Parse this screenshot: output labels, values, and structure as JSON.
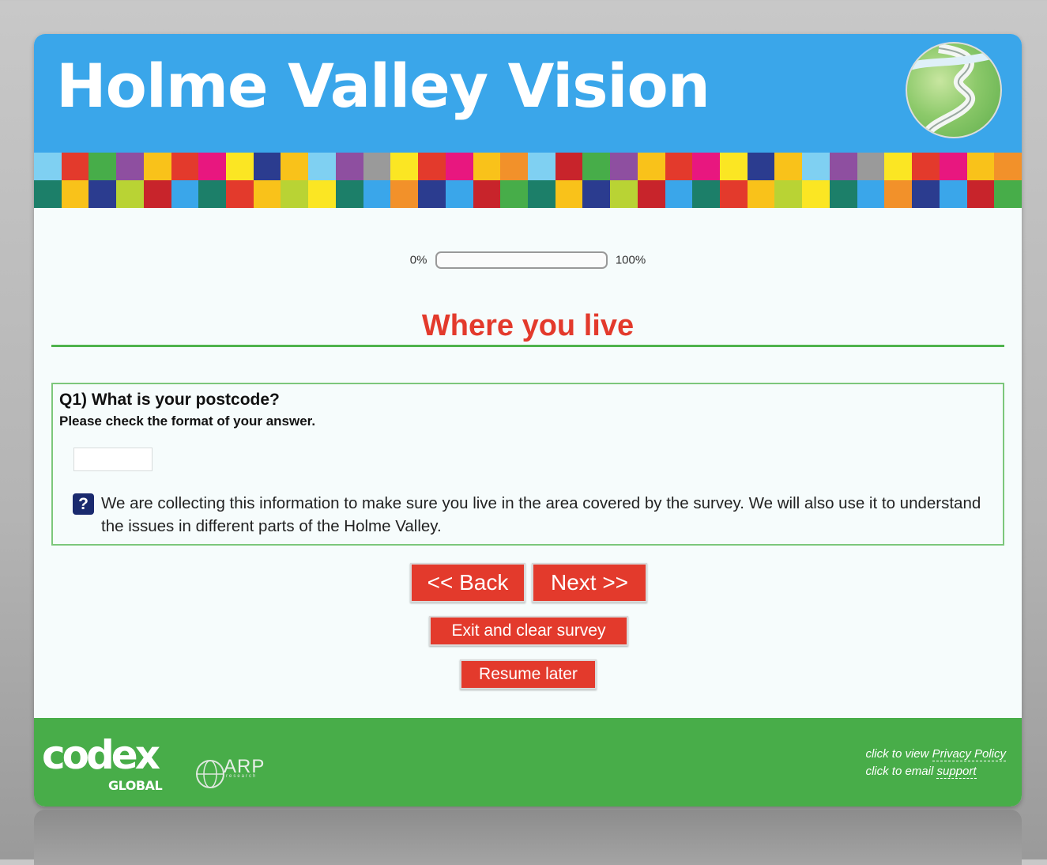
{
  "header": {
    "title": "Holme Valley Vision",
    "mosaic_colors": [
      "#7fd0f2",
      "#e33a2c",
      "#47ad49",
      "#8e4fa0",
      "#f9c21a",
      "#e33a2c",
      "#e8177f",
      "#fbe623",
      "#2b3c8f",
      "#f9c21a",
      "#7fd0f2",
      "#8e4fa0",
      "#9a9a9a",
      "#fbe623",
      "#e33a2c",
      "#e8177f",
      "#f9c21a",
      "#f2912a",
      "#7fd0f2",
      "#c8242b",
      "#47ad49",
      "#8e4fa0",
      "#f9c21a",
      "#e33a2c",
      "#e8177f",
      "#fbe623",
      "#2b3c8f",
      "#f9c21a",
      "#7fd0f2",
      "#8e4fa0",
      "#9a9a9a",
      "#fbe623",
      "#e33a2c",
      "#e8177f",
      "#f9c21a",
      "#f2912a",
      "#1c7f69",
      "#f9c21a",
      "#2b3c8f",
      "#b9d334",
      "#c8242b",
      "#3aa6ea",
      "#1c7f69",
      "#e33a2c",
      "#f9c21a",
      "#b9d334",
      "#fbe623",
      "#1c7f69",
      "#3aa6ea",
      "#f2912a",
      "#2b3c8f",
      "#3aa6ea",
      "#c8242b",
      "#47ad49",
      "#1c7f69",
      "#f9c21a",
      "#2b3c8f",
      "#b9d334",
      "#c8242b",
      "#3aa6ea",
      "#1c7f69",
      "#e33a2c",
      "#f9c21a",
      "#b9d334",
      "#fbe623",
      "#1c7f69",
      "#3aa6ea",
      "#f2912a",
      "#2b3c8f",
      "#3aa6ea",
      "#c8242b",
      "#47ad49"
    ]
  },
  "progress": {
    "start_label": "0%",
    "end_label": "100%",
    "value": 0
  },
  "section": {
    "title": "Where you live"
  },
  "question": {
    "title": "Q1) What is your postcode?",
    "error": "Please check the format of your answer.",
    "postcode_value": "",
    "help_icon": "?",
    "help_text": "We are collecting this information to make sure you live in the area covered by the survey. We will also use it to understand the issues in different parts of the Holme Valley."
  },
  "buttons": {
    "back": "<< Back",
    "next": "Next >>",
    "exit": "Exit and clear survey",
    "resume": "Resume later"
  },
  "footer": {
    "codex_logo": "codex",
    "codex_sub": "GLOBAL",
    "arp_logo": "ARP",
    "arp_sub": "research",
    "privacy_prefix": "click to view ",
    "privacy_link": "Privacy Policy",
    "support_prefix": "click to email ",
    "support_link": "support"
  },
  "colors": {
    "header_blue": "#3aa6ea",
    "accent_red": "#e33a2c",
    "footer_green": "#48ad49",
    "help_icon_navy": "#1a2a6e"
  }
}
